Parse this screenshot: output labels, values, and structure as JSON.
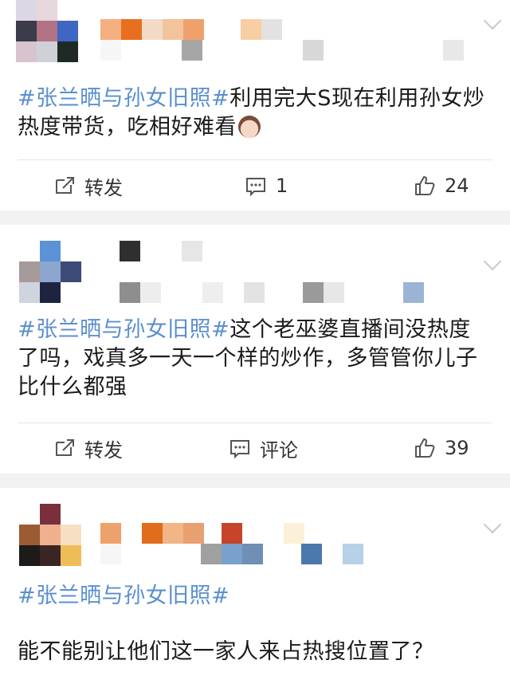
{
  "posts": [
    {
      "tag": "#张兰晒与孙女旧照#",
      "text": "利用完大S现在利用孙女炒热度带货，吃相好难看",
      "emoji_icon": "woman-face-icon",
      "share_label": "转发",
      "comment_label": "1",
      "like_label": "24"
    },
    {
      "tag": "#张兰晒与孙女旧照#",
      "text": "这个老巫婆直播间没热度了吗，戏真多一天一个样的炒作，多管管你儿子比什么都强",
      "share_label": "转发",
      "comment_label": "评论",
      "like_label": "39"
    },
    {
      "tag": "#张兰晒与孙女旧照#",
      "text": "能不能别让他们这一家人来占热搜位置了？"
    }
  ],
  "colors": {
    "tag": "#5b8fd0",
    "separator": "#f2f2f2"
  }
}
